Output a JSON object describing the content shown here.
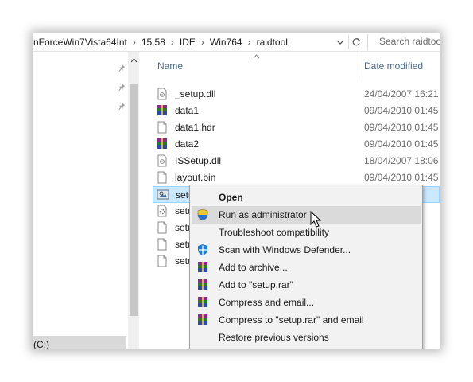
{
  "address_bar": {
    "breadcrumbs": [
      "nForceWin7Vista64Int",
      "15.58",
      "IDE",
      "Win764",
      "raidtool"
    ],
    "separator": "›",
    "search_placeholder": "Search raidtool"
  },
  "nav_pane": {
    "drive_label": "(C:)",
    "pin_icons": [
      "pin-icon",
      "pin-icon",
      "pin-icon"
    ]
  },
  "file_list": {
    "columns": {
      "name": "Name",
      "date_modified": "Date modified"
    },
    "rows": [
      {
        "name": "_setup.dll",
        "date": "24/04/2007 16:21",
        "icon": "dll-file-icon"
      },
      {
        "name": "data1",
        "date": "09/04/2010 01:45",
        "icon": "winrar-archive-icon"
      },
      {
        "name": "data1.hdr",
        "date": "09/04/2010 01:45",
        "icon": "blank-file-icon"
      },
      {
        "name": "data2",
        "date": "09/04/2010 01:45",
        "icon": "winrar-archive-icon"
      },
      {
        "name": "ISSetup.dll",
        "date": "18/04/2007 18:06",
        "icon": "dll-file-icon"
      },
      {
        "name": "layout.bin",
        "date": "09/04/2010 01:45",
        "icon": "blank-file-icon"
      },
      {
        "name": "setu",
        "date": "45",
        "icon": "setup-exe-icon",
        "selected": true
      },
      {
        "name": "setu",
        "date": "45",
        "icon": "settings-file-icon"
      },
      {
        "name": "setu",
        "date": "45",
        "icon": "blank-file-icon"
      },
      {
        "name": "setu",
        "date": "47",
        "icon": "blank-file-icon"
      },
      {
        "name": "setu",
        "date": "00",
        "icon": "blank-file-icon"
      }
    ]
  },
  "context_menu": {
    "items": [
      {
        "label": "Open",
        "bold": true,
        "icon": ""
      },
      {
        "label": "Run as administrator",
        "icon": "uac-shield-icon",
        "highlighted": true
      },
      {
        "label": "Troubleshoot compatibility",
        "icon": ""
      },
      {
        "label": "Scan with Windows Defender...",
        "icon": "windows-defender-icon"
      },
      {
        "label": "Add to archive...",
        "icon": "winrar-icon"
      },
      {
        "label": "Add to \"setup.rar\"",
        "icon": "winrar-icon"
      },
      {
        "label": "Compress and email...",
        "icon": "winrar-icon"
      },
      {
        "label": "Compress to \"setup.rar\" and email",
        "icon": "winrar-icon"
      },
      {
        "label": "Restore previous versions",
        "icon": ""
      }
    ]
  },
  "colors": {
    "selection_bg": "#cce8ff",
    "selection_border": "#99d1ff",
    "menu_bg": "#f2f2f2",
    "menu_highlight": "#dadada",
    "header_text": "#4a6b8a"
  }
}
